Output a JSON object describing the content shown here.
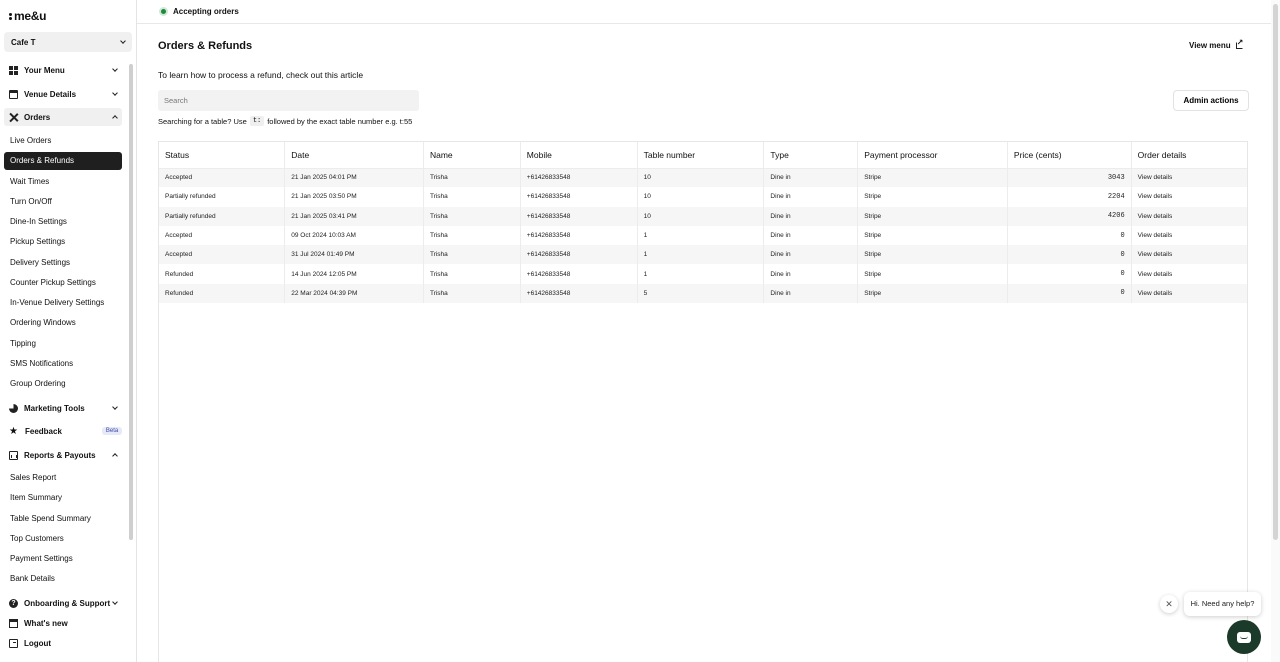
{
  "sidebar": {
    "logo": "me&u",
    "venue": "Cafe T",
    "sections": {
      "your_menu": "Your Menu",
      "venue_details": "Venue Details",
      "orders": "Orders",
      "marketing_tools": "Marketing Tools",
      "feedback": "Feedback",
      "feedback_badge": "Beta",
      "reports_payouts": "Reports & Payouts",
      "onboarding_support": "Onboarding & Support",
      "whats_new": "What's new",
      "logout": "Logout"
    },
    "order_items": [
      "Live Orders",
      "Orders & Refunds",
      "Wait Times",
      "Turn On/Off",
      "Dine-In Settings",
      "Pickup Settings",
      "Delivery Settings",
      "Counter Pickup Settings",
      "In-Venue Delivery Settings",
      "Ordering Windows",
      "Tipping",
      "SMS Notifications",
      "Group Ordering"
    ],
    "report_items": [
      "Sales Report",
      "Item Summary",
      "Table Spend Summary",
      "Top Customers",
      "Payment Settings",
      "Bank Details"
    ]
  },
  "topbar": {
    "status": "Accepting orders",
    "status_color": "#1d8a3b"
  },
  "main": {
    "title": "Orders & Refunds",
    "view_menu": "View menu",
    "refund_hint": "To learn how to process a refund, check out this article",
    "search_placeholder": "Search",
    "admin_actions": "Admin actions",
    "table_hint_prefix": "Searching for a table? Use",
    "table_hint_code": "t:",
    "table_hint_suffix": "followed by the exact table number e.g. t:55"
  },
  "table": {
    "headers": [
      "Status",
      "Date",
      "Name",
      "Mobile",
      "Table number",
      "Type",
      "Payment processor",
      "Price (cents)",
      "Order details"
    ],
    "rows": [
      [
        "Accepted",
        "21 Jan 2025 04:01 PM",
        "Trisha",
        "+61426833548",
        "10",
        "Dine in",
        "Stripe",
        "3043",
        "View details"
      ],
      [
        "Partially refunded",
        "21 Jan 2025 03:50 PM",
        "Trisha",
        "+61426833548",
        "10",
        "Dine in",
        "Stripe",
        "2204",
        "View details"
      ],
      [
        "Partially refunded",
        "21 Jan 2025 03:41 PM",
        "Trisha",
        "+61426833548",
        "10",
        "Dine in",
        "Stripe",
        "4206",
        "View details"
      ],
      [
        "Accepted",
        "09 Oct 2024 10:03 AM",
        "Trisha",
        "+61426833548",
        "1",
        "Dine in",
        "Stripe",
        "0",
        "View details"
      ],
      [
        "Accepted",
        "31 Jul 2024 01:49 PM",
        "Trisha",
        "+61426833548",
        "1",
        "Dine in",
        "Stripe",
        "0",
        "View details"
      ],
      [
        "Refunded",
        "14 Jun 2024 12:05 PM",
        "Trisha",
        "+61426833548",
        "1",
        "Dine in",
        "Stripe",
        "0",
        "View details"
      ],
      [
        "Refunded",
        "22 Mar 2024 04:39 PM",
        "Trisha",
        "+61426833548",
        "5",
        "Dine in",
        "Stripe",
        "0",
        "View details"
      ]
    ]
  },
  "help_widget": {
    "message": "Hi. Need any help?",
    "close_symbol": "✕"
  }
}
